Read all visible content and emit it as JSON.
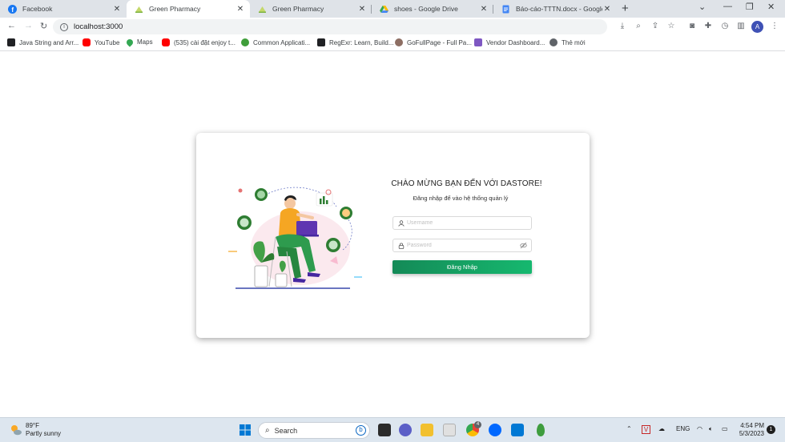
{
  "browser": {
    "tabs": [
      {
        "title": "Facebook",
        "active": false
      },
      {
        "title": "Green Pharmacy",
        "active": true
      },
      {
        "title": "Green Pharmacy",
        "active": false
      },
      {
        "title": "shoes - Google Drive",
        "active": false
      },
      {
        "title": "Báo-cáo-TTTN.docx - Google Tài",
        "active": false
      }
    ],
    "url": "localhost:3000",
    "profile_initial": "A",
    "bookmarks": [
      {
        "label": "Java String and Arr...",
        "icon": "q-icon",
        "color": "#202124"
      },
      {
        "label": "YouTube",
        "icon": "youtube-icon",
        "color": "#ff0000"
      },
      {
        "label": "Maps",
        "icon": "maps-icon",
        "color": "#34a853"
      },
      {
        "label": "(535) cài đặt enjoy t...",
        "icon": "youtube-icon",
        "color": "#ff0000"
      },
      {
        "label": "Common Applicati...",
        "icon": "common-app-icon",
        "color": "#3f9e3a"
      },
      {
        "label": "RegExr: Learn, Build...",
        "icon": "regexr-icon",
        "color": "#202124"
      },
      {
        "label": "GoFullPage - Full Pa...",
        "icon": "gofullpage-icon",
        "color": "#8d6e63"
      },
      {
        "label": "Vendor Dashboard...",
        "icon": "vendor-icon",
        "color": "#7e57c2"
      },
      {
        "label": "Thẻ mới",
        "icon": "globe-icon",
        "color": "#5f6368"
      }
    ]
  },
  "login": {
    "welcome": "CHÀO MỪNG BẠN ĐẾN VỚI DASTORE!",
    "subtitle": "Đăng nhập để vào hệ thống quản lý",
    "username_placeholder": "Username",
    "password_placeholder": "Password",
    "button": "Đăng Nhập"
  },
  "taskbar": {
    "temperature": "89°F",
    "condition": "Partly sunny",
    "search": "Search",
    "chrome_badge": "4",
    "language": "ENG",
    "time": "4:54 PM",
    "date": "5/3/2023",
    "notifications": "1"
  },
  "colors": {
    "accent_green": "#16a366",
    "tab_strip": "#dfe3e8",
    "taskbar": "#dde6ef"
  }
}
